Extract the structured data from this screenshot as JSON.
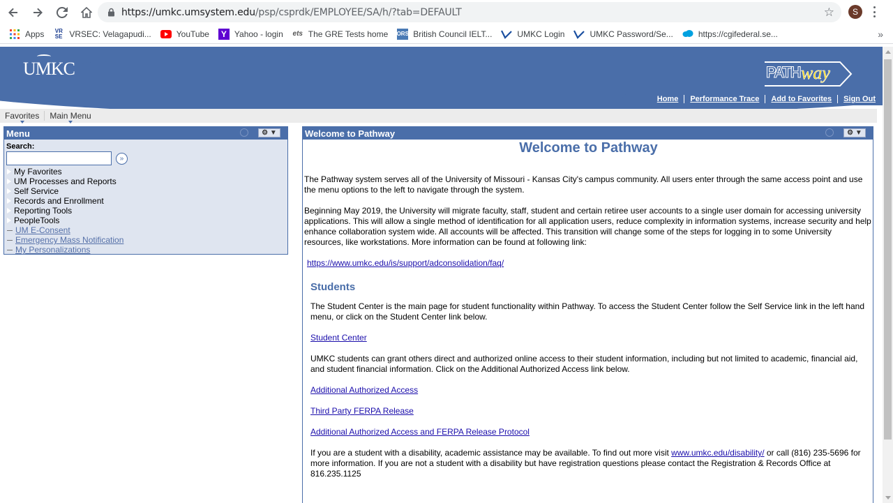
{
  "browser": {
    "url_host": "https://umkc.umsystem.edu",
    "url_path": "/psp/csprdk/EMPLOYEE/SA/h/?tab=DEFAULT",
    "profile_initial": "S",
    "bookmarks": [
      {
        "label": "Apps",
        "icon": "apps-grid-icon"
      },
      {
        "label": "VRSEC: Velagapudi...",
        "icon": "vrsec-icon"
      },
      {
        "label": "YouTube",
        "icon": "youtube-icon"
      },
      {
        "label": "Yahoo - login",
        "icon": "yahoo-icon"
      },
      {
        "label": "The GRE Tests home",
        "icon": "ets-icon"
      },
      {
        "label": "British Council IELT...",
        "icon": "ielts-icon"
      },
      {
        "label": "UMKC Login",
        "icon": "umkc-icon"
      },
      {
        "label": "UMKC Password/Se...",
        "icon": "umkc-icon"
      },
      {
        "label": "https://cgifederal.se...",
        "icon": "salesforce-cloud-icon"
      }
    ]
  },
  "header": {
    "logo_text": "UMKC",
    "brand": "PATHway",
    "nav": [
      "Home",
      "Performance Trace",
      "Add to Favorites",
      "Sign Out"
    ]
  },
  "menubar": {
    "items": [
      "Favorites",
      "Main Menu"
    ]
  },
  "menu": {
    "title": "Menu",
    "search_label": "Search:",
    "search_value": "",
    "folders": [
      "My Favorites",
      "UM Processes and Reports",
      "Self Service",
      "Records and Enrollment",
      "Reporting Tools",
      "PeopleTools"
    ],
    "links": [
      "UM E-Consent",
      "Emergency Mass Notification",
      "My Personalizations"
    ]
  },
  "welcome": {
    "pagelet_title": "Welcome to Pathway",
    "heading": "Welcome to Pathway",
    "p1": "The Pathway system serves all of the University of Missouri - Kansas City's campus community. All users enter through the same access point and use the menu options to the left to navigate through the system.",
    "p2": "Beginning May 2019, the University will migrate faculty, staff, student and certain retiree user accounts to a single user domain for accessing university applications. This will allow a single method of identification for all application users, reduce complexity in information systems, increase security and help enhance collaboration system wide. All accounts will be affected. This transition will change some of the steps for logging in to some University resources, like workstations. More information can be found at following link:",
    "faq_link": "https://www.umkc.edu/is/support/adconsolidation/faq/",
    "students_title": "Students",
    "s1": "The Student Center is the main page for student functionality within Pathway. To access the Student Center follow the Self Service link in the left hand menu, or click on the Student Center link below.",
    "student_center_link": "Student Center",
    "s2": "UMKC students can grant others direct and authorized online access to their student information, including but not limited to academic, financial aid, and student financial information. Click on the Additional Authorized Access link below.",
    "aaa_link": "Additional Authorized Access",
    "ferpa_link": "Third Party FERPA Release",
    "protocol_link": "Additional Authorized Access and FERPA Release Protocol",
    "s3_a": "If you are a student with a disability, academic assistance may be available. To find out more visit ",
    "disability_link": "www.umkc.edu/disability/",
    "s3_b": " or call (816) 235-5696 for more information. If you are not a student with a disability but have registration questions please contact the Registration & Records Office at 816.235.1125"
  },
  "colors": {
    "banner_blue": "#4a6ea9",
    "banner_yellow": "#f6d300",
    "menu_bg": "#dfe5f0",
    "link": "#1a0dab"
  }
}
